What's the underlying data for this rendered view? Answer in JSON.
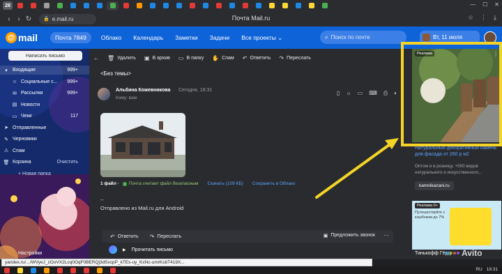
{
  "browser": {
    "tab_count": "28",
    "url": "e.mail.ru",
    "page_title": "Почта Mail.ru",
    "tab_colors": [
      "#e53935",
      "#e53935",
      "#9e9e9e",
      "#4caf50",
      "#1e88e5",
      "#1e88e5",
      "#1e88e5",
      "#4caf50",
      "#e53935",
      "#ff9800",
      "#1e88e5",
      "#1e88e5",
      "#1e88e5",
      "#e53935",
      "#1e88e5",
      "#e53935",
      "#1e88e5",
      "#e53935",
      "#1e88e5",
      "#fdd835",
      "#fdd835",
      "#1e88e5",
      "#fdd835",
      "#4caf50"
    ],
    "nav_icons": [
      "back-icon",
      "forward-icon",
      "reload-icon"
    ],
    "window_controls": [
      "minimize-icon",
      "maximize-icon",
      "close-icon"
    ]
  },
  "header": {
    "logo_at": "@",
    "logo_word": "mail",
    "inbox_label": "Почта 7849",
    "nav": [
      "Облако",
      "Календарь",
      "Заметки",
      "Задачи",
      "Все проекты ⌄"
    ],
    "search_placeholder": "Поиск по почте",
    "date": "Вт, 11 июля"
  },
  "sidebar": {
    "compose": "Написать письмо",
    "folders": [
      {
        "name": "Входящие",
        "count": "999+",
        "icon": "inbox-icon",
        "selected": true,
        "sub": false
      },
      {
        "name": "Социальные с...",
        "count": "999+",
        "icon": "people-icon",
        "selected": false,
        "sub": true
      },
      {
        "name": "Рассылки",
        "count": "999+",
        "icon": "newsletter-icon",
        "selected": false,
        "sub": true
      },
      {
        "name": "Новости",
        "count": "",
        "icon": "news-icon",
        "selected": false,
        "sub": true
      },
      {
        "name": "Чеки",
        "count": "117",
        "icon": "receipt-icon",
        "selected": false,
        "sub": true
      },
      {
        "name": "Отправленные",
        "count": "",
        "icon": "sent-icon",
        "selected": false,
        "sub": false
      },
      {
        "name": "Черновики",
        "count": "",
        "icon": "draft-icon",
        "selected": false,
        "sub": false
      },
      {
        "name": "Спам",
        "count": "",
        "icon": "spam-icon",
        "selected": false,
        "sub": false
      },
      {
        "name": "Корзина",
        "count": "",
        "icon": "trash-icon",
        "selected": false,
        "sub": false
      }
    ],
    "clean_label": "Очистить",
    "new_folder": "+ Новая папка",
    "settings": "Настройки"
  },
  "toolbar": {
    "buttons": [
      {
        "label": "Удалить",
        "icon": "trash-icon"
      },
      {
        "label": "В архив",
        "icon": "archive-icon"
      },
      {
        "label": "В папку",
        "icon": "folder-icon"
      },
      {
        "label": "Спам",
        "icon": "thumb-down-icon"
      },
      {
        "label": "Ответить",
        "icon": "reply-icon"
      },
      {
        "label": "Переслать",
        "icon": "forward-icon"
      }
    ]
  },
  "message": {
    "subject": "<Без темы>",
    "sender": "Альбина Кожевникова",
    "time": "Сегодня, 18:31",
    "to": "Кому: вам",
    "attach_count": "1 файл ·",
    "safe_text": "Почта считает файл безопасным",
    "download": "Скачать (109 КБ)",
    "save_cloud": "Сохранить в Облако",
    "dashes": "--",
    "signature": "Отправлено из Mail.ru для Android",
    "reply": "Ответить",
    "forward": "Переслать",
    "call": "Предложить звонок",
    "voice_label": "Прочитать письмо"
  },
  "ads": {
    "badge": "Реклама",
    "ad1_title": "Натуральный декоративный камень для фасада от 260 р м2",
    "ad1_text": "Оптом и в розницу. +500 видов натурального и искусственного...",
    "ad1_button": "kamnikazani.ru",
    "ad2_badge": "Реклама 0+",
    "ad2_text": "Путешествуйте с кэшбэком до 7%",
    "ad2_title": "Тинькофф Гёрд",
    "watermark": "Avito"
  },
  "status_url": "yandex.ru/.../WVyeJ_zOoVX2Lcq0OqF0BERQj3dSxcpP_kTEs-uy_KxNc-umrKsbT419X...",
  "taskbar": {
    "icon_colors": [
      "#e53935",
      "#fdd835",
      "#1e88e5",
      "#ff9800",
      "#e53935",
      "#e53935",
      "#e53935",
      "#ff9800",
      "#e53935"
    ],
    "lang": "RU",
    "time": "18:31"
  },
  "accent": {
    "mail_blue": "#0f63d8",
    "highlight_yellow": "#f5d428"
  }
}
